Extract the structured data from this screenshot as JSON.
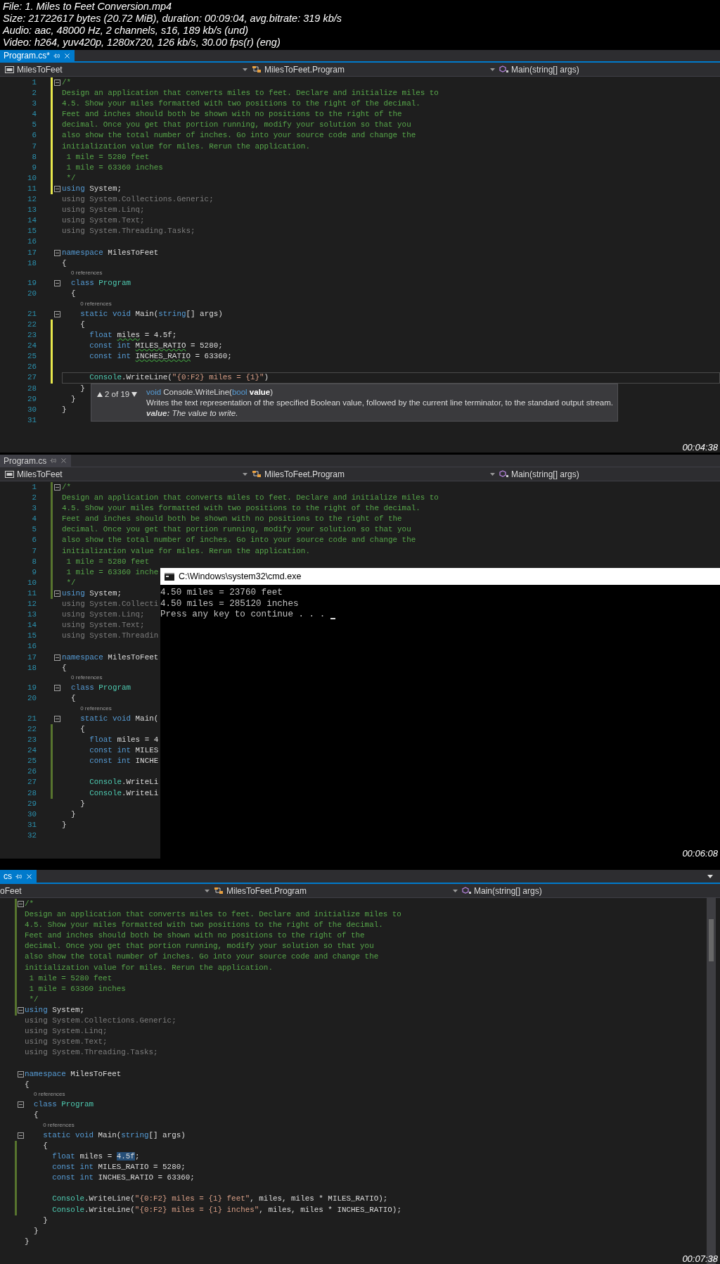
{
  "header": [
    "File: 1. Miles to Feet Conversion.mp4",
    "Size: 21722617 bytes (20.72 MiB), duration: 00:09:04, avg.bitrate: 319 kb/s",
    "Audio: aac, 48000 Hz, 2 channels, s16, 189 kb/s (und)",
    "Video: h264, yuv420p, 1280x720, 126 kb/s, 30.00 fps(r) (eng)"
  ],
  "frames": [
    {
      "kind": "full",
      "tab": {
        "label": "Program.cs*",
        "selected": true,
        "saved": false
      },
      "nav": [
        {
          "label": "MilesToFeet"
        },
        {
          "label": "MilesToFeet.Program"
        },
        {
          "label": "Main(string[] args)"
        }
      ],
      "lines": [
        {
          "kind": "code",
          "number": "1",
          "fold": true,
          "modified": true,
          "current": false,
          "segments": [
            {
              "kind": "comment",
              "text": "/*"
            }
          ]
        },
        {
          "kind": "code",
          "number": "2",
          "fold": false,
          "modified": true,
          "current": false,
          "segments": [
            {
              "kind": "comment",
              "text": "Design an application that converts miles to feet. Declare and initialize miles to"
            }
          ]
        },
        {
          "kind": "code",
          "number": "3",
          "fold": false,
          "modified": true,
          "current": false,
          "segments": [
            {
              "kind": "comment",
              "text": "4.5. Show your miles formatted with two positions to the right of the decimal."
            }
          ]
        },
        {
          "kind": "code",
          "number": "4",
          "fold": false,
          "modified": true,
          "current": false,
          "segments": [
            {
              "kind": "comment",
              "text": "Feet and inches should both be shown with no positions to the right of the"
            }
          ]
        },
        {
          "kind": "code",
          "number": "5",
          "fold": false,
          "modified": true,
          "current": false,
          "segments": [
            {
              "kind": "comment",
              "text": "decimal. Once you get that portion running, modify your solution so that you"
            }
          ]
        },
        {
          "kind": "code",
          "number": "6",
          "fold": false,
          "modified": true,
          "current": false,
          "segments": [
            {
              "kind": "comment",
              "text": "also show the total number of inches. Go into your source code and change the"
            }
          ]
        },
        {
          "kind": "code",
          "number": "7",
          "fold": false,
          "modified": true,
          "current": false,
          "segments": [
            {
              "kind": "comment",
              "text": "initialization value for miles. Rerun the application."
            }
          ]
        },
        {
          "kind": "code",
          "number": "8",
          "fold": false,
          "modified": true,
          "current": false,
          "segments": [
            {
              "kind": "comment",
              "text": " 1 mile = 5280 feet"
            }
          ]
        },
        {
          "kind": "code",
          "number": "9",
          "fold": false,
          "modified": true,
          "current": false,
          "segments": [
            {
              "kind": "comment",
              "text": " 1 mile = 63360 inches"
            }
          ]
        },
        {
          "kind": "code",
          "number": "10",
          "fold": false,
          "modified": true,
          "current": false,
          "segments": [
            {
              "kind": "comment",
              "text": " */"
            }
          ]
        },
        {
          "kind": "code",
          "number": "11",
          "fold": true,
          "modified": true,
          "current": false,
          "segments": [
            {
              "kind": "keyword",
              "text": "using"
            },
            {
              "kind": "plain",
              "text": " System;"
            }
          ]
        },
        {
          "kind": "code",
          "number": "12",
          "fold": false,
          "modified": false,
          "current": false,
          "segments": [
            {
              "kind": "dimmed",
              "text": "using System.Collections.Generic;"
            }
          ]
        },
        {
          "kind": "code",
          "number": "13",
          "fold": false,
          "modified": false,
          "current": false,
          "segments": [
            {
              "kind": "dimmed",
              "text": "using System.Linq;"
            }
          ]
        },
        {
          "kind": "code",
          "number": "14",
          "fold": false,
          "modified": false,
          "current": false,
          "segments": [
            {
              "kind": "dimmed",
              "text": "using System.Text;"
            }
          ]
        },
        {
          "kind": "code",
          "number": "15",
          "fold": false,
          "modified": false,
          "current": false,
          "segments": [
            {
              "kind": "dimmed",
              "text": "using System.Threading.Tasks;"
            }
          ]
        },
        {
          "kind": "code",
          "number": "16",
          "fold": false,
          "modified": false,
          "current": false
        },
        {
          "kind": "code",
          "number": "17",
          "fold": true,
          "modified": false,
          "current": false,
          "segments": [
            {
              "kind": "keyword",
              "text": "namespace"
            },
            {
              "kind": "plain",
              "text": " MilesToFeet"
            }
          ]
        },
        {
          "kind": "code",
          "number": "18",
          "fold": false,
          "modified": false,
          "current": false,
          "segments": [
            {
              "kind": "plain",
              "text": "{"
            }
          ]
        },
        {
          "kind": "codelens",
          "text": "0 references"
        },
        {
          "kind": "code",
          "number": "19",
          "fold": true,
          "modified": false,
          "current": false,
          "segments": [
            {
              "kind": "keyword",
              "text": "  class"
            },
            {
              "kind": "type",
              "text": " Program"
            }
          ]
        },
        {
          "kind": "code",
          "number": "20",
          "fold": false,
          "modified": false,
          "current": false,
          "segments": [
            {
              "kind": "plain",
              "text": "  {"
            }
          ]
        },
        {
          "kind": "codelens",
          "text": "0 references"
        },
        {
          "kind": "code",
          "number": "21",
          "fold": true,
          "modified": false,
          "current": false,
          "segments": [
            {
              "kind": "keyword",
              "text": "    static void"
            },
            {
              "kind": "plain",
              "text": " Main("
            },
            {
              "kind": "keyword",
              "text": "string"
            },
            {
              "kind": "plain",
              "text": "[] args)"
            }
          ]
        },
        {
          "kind": "code",
          "number": "22",
          "fold": false,
          "modified": true,
          "current": false,
          "segments": [
            {
              "kind": "plain",
              "text": "    {"
            }
          ]
        },
        {
          "kind": "code",
          "number": "23",
          "fold": false,
          "modified": true,
          "current": false,
          "segments": [
            {
              "kind": "keyword",
              "text": "      float "
            },
            {
              "kind": "warning",
              "text": "miles"
            },
            {
              "kind": "plain",
              "text": " = 4.5f;"
            }
          ]
        },
        {
          "kind": "code",
          "number": "24",
          "fold": false,
          "modified": true,
          "current": false,
          "segments": [
            {
              "kind": "keyword",
              "text": "      const int "
            },
            {
              "kind": "warning",
              "text": "MILES_RATIO"
            },
            {
              "kind": "plain",
              "text": " = 5280;"
            }
          ]
        },
        {
          "kind": "code",
          "number": "25",
          "fold": false,
          "modified": true,
          "current": false,
          "segments": [
            {
              "kind": "keyword",
              "text": "      const int "
            },
            {
              "kind": "warning",
              "text": "INCHES_RATIO"
            },
            {
              "kind": "plain",
              "text": " = 63360;"
            }
          ]
        },
        {
          "kind": "code",
          "number": "26",
          "fold": false,
          "modified": true,
          "current": false
        },
        {
          "kind": "code",
          "number": "27",
          "fold": false,
          "modified": true,
          "current": true,
          "segments": [
            {
              "kind": "type",
              "text": "      Console"
            },
            {
              "kind": "plain",
              "text": ".WriteLine("
            },
            {
              "kind": "string",
              "text": "\"{0:F2} miles = {1}\""
            },
            {
              "kind": "plain",
              "text": ")"
            }
          ]
        },
        {
          "kind": "code",
          "number": "28",
          "fold": false,
          "modified": false,
          "current": false,
          "segments": [
            {
              "kind": "plain",
              "text": "    }"
            }
          ]
        },
        {
          "kind": "code",
          "number": "29",
          "fold": false,
          "modified": false,
          "current": false,
          "segments": [
            {
              "kind": "plain",
              "text": "  }"
            }
          ]
        },
        {
          "kind": "code",
          "number": "30",
          "fold": false,
          "modified": false,
          "current": false,
          "segments": [
            {
              "kind": "plain",
              "text": "}"
            }
          ]
        },
        {
          "kind": "code",
          "number": "31",
          "fold": false,
          "modified": false,
          "current": false
        }
      ],
      "tooltip": {
        "counter": "2 of 19",
        "signature": [
          {
            "kind": "keyword",
            "text": "void"
          },
          {
            "kind": "plain",
            "text": " Console.WriteLine("
          },
          {
            "kind": "keyword",
            "text": "bool"
          },
          {
            "kind": "param",
            "text": " value"
          },
          {
            "kind": "plain",
            "text": ")"
          }
        ],
        "description": "Writes the text representation of the specified Boolean value, followed by the current line terminator, to the standard output stream.",
        "parameter": "**value:** The value to write."
      },
      "timestamp": "00:04:38"
    },
    {
      "kind": "full",
      "tab": {
        "label": "Program.cs",
        "selected": false,
        "saved": true
      },
      "nav": [
        {
          "label": "MilesToFeet"
        },
        {
          "label": "MilesToFeet.Program"
        },
        {
          "label": "Main(string[] args)"
        }
      ],
      "lines": [
        {
          "kind": "code",
          "number": "1",
          "fold": true,
          "modified": true,
          "segments": [
            {
              "kind": "comment",
              "text": "/*"
            }
          ]
        },
        {
          "kind": "code",
          "number": "2",
          "fold": false,
          "modified": true,
          "segments": [
            {
              "kind": "comment",
              "text": "Design an application that converts miles to feet. Declare and initialize miles to"
            }
          ]
        },
        {
          "kind": "code",
          "number": "3",
          "fold": false,
          "modified": true,
          "segments": [
            {
              "kind": "comment",
              "text": "4.5. Show your miles formatted with two positions to the right of the decimal."
            }
          ]
        },
        {
          "kind": "code",
          "number": "4",
          "fold": false,
          "modified": true,
          "segments": [
            {
              "kind": "comment",
              "text": "Feet and inches should both be shown with no positions to the right of the"
            }
          ]
        },
        {
          "kind": "code",
          "number": "5",
          "fold": false,
          "modified": true,
          "segments": [
            {
              "kind": "comment",
              "text": "decimal. Once you get that portion running, modify your solution so that you"
            }
          ]
        },
        {
          "kind": "code",
          "number": "6",
          "fold": false,
          "modified": true,
          "segments": [
            {
              "kind": "comment",
              "text": "also show the total number of inches. Go into your source code and change the"
            }
          ]
        },
        {
          "kind": "code",
          "number": "7",
          "fold": false,
          "modified": true,
          "segments": [
            {
              "kind": "comment",
              "text": "initialization value for miles. Rerun the application."
            }
          ]
        },
        {
          "kind": "code",
          "number": "8",
          "fold": false,
          "modified": true,
          "segments": [
            {
              "kind": "comment",
              "text": " 1 mile = 5280 feet"
            }
          ]
        },
        {
          "kind": "code",
          "number": "9",
          "fold": false,
          "modified": true,
          "segments": [
            {
              "kind": "comment",
              "text": " 1 mile = 63360 inche"
            }
          ]
        },
        {
          "kind": "code",
          "number": "10",
          "fold": false,
          "modified": true,
          "segments": [
            {
              "kind": "comment",
              "text": " */"
            }
          ]
        },
        {
          "kind": "code",
          "number": "11",
          "fold": true,
          "modified": true,
          "segments": [
            {
              "kind": "keyword",
              "text": "using"
            },
            {
              "kind": "plain",
              "text": " System;"
            }
          ]
        },
        {
          "kind": "code",
          "number": "12",
          "fold": false,
          "modified": false,
          "segments": [
            {
              "kind": "dimmed",
              "text": "using System.Collecti"
            }
          ]
        },
        {
          "kind": "code",
          "number": "13",
          "fold": false,
          "modified": false,
          "segments": [
            {
              "kind": "dimmed",
              "text": "using System.Linq;"
            }
          ]
        },
        {
          "kind": "code",
          "number": "14",
          "fold": false,
          "modified": false,
          "segments": [
            {
              "kind": "dimmed",
              "text": "using System.Text;"
            }
          ]
        },
        {
          "kind": "code",
          "number": "15",
          "fold": false,
          "modified": false,
          "segments": [
            {
              "kind": "dimmed",
              "text": "using System.Threadin"
            }
          ]
        },
        {
          "kind": "code",
          "number": "16",
          "fold": false,
          "modified": false
        },
        {
          "kind": "code",
          "number": "17",
          "fold": true,
          "modified": false,
          "segments": [
            {
              "kind": "keyword",
              "text": "namespace"
            },
            {
              "kind": "plain",
              "text": " MilesToFeet"
            }
          ]
        },
        {
          "kind": "code",
          "number": "18",
          "fold": false,
          "modified": false,
          "segments": [
            {
              "kind": "plain",
              "text": "{"
            }
          ]
        },
        {
          "kind": "codelens",
          "text": "0 references"
        },
        {
          "kind": "code",
          "number": "19",
          "fold": true,
          "modified": false,
          "segments": [
            {
              "kind": "keyword",
              "text": "  class"
            },
            {
              "kind": "type",
              "text": " Program"
            }
          ]
        },
        {
          "kind": "code",
          "number": "20",
          "fold": false,
          "modified": false,
          "segments": [
            {
              "kind": "plain",
              "text": "  {"
            }
          ]
        },
        {
          "kind": "codelens",
          "text": "0 references"
        },
        {
          "kind": "code",
          "number": "21",
          "fold": true,
          "modified": false,
          "segments": [
            {
              "kind": "keyword",
              "text": "    static void"
            },
            {
              "kind": "plain",
              "text": " Main("
            }
          ]
        },
        {
          "kind": "code",
          "number": "22",
          "fold": false,
          "modified": true,
          "segments": [
            {
              "kind": "plain",
              "text": "    {"
            }
          ]
        },
        {
          "kind": "code",
          "number": "23",
          "fold": false,
          "modified": true,
          "segments": [
            {
              "kind": "keyword",
              "text": "      float"
            },
            {
              "kind": "plain",
              "text": " miles = 4"
            }
          ]
        },
        {
          "kind": "code",
          "number": "24",
          "fold": false,
          "modified": true,
          "segments": [
            {
              "kind": "keyword",
              "text": "      const int"
            },
            {
              "kind": "plain",
              "text": " MILES"
            }
          ]
        },
        {
          "kind": "code",
          "number": "25",
          "fold": false,
          "modified": true,
          "segments": [
            {
              "kind": "keyword",
              "text": "      const int"
            },
            {
              "kind": "plain",
              "text": " INCHE"
            }
          ]
        },
        {
          "kind": "code",
          "number": "26",
          "fold": false,
          "modified": true
        },
        {
          "kind": "code",
          "number": "27",
          "fold": false,
          "modified": true,
          "segments": [
            {
              "kind": "type",
              "text": "      Console"
            },
            {
              "kind": "plain",
              "text": ".WriteLi"
            }
          ]
        },
        {
          "kind": "code",
          "number": "28",
          "fold": false,
          "modified": true,
          "segments": [
            {
              "kind": "type",
              "text": "      Console"
            },
            {
              "kind": "plain",
              "text": ".WriteLi"
            }
          ]
        },
        {
          "kind": "code",
          "number": "29",
          "fold": false,
          "modified": false,
          "segments": [
            {
              "kind": "plain",
              "text": "    }"
            }
          ]
        },
        {
          "kind": "code",
          "number": "30",
          "fold": false,
          "modified": false,
          "segments": [
            {
              "kind": "plain",
              "text": "  }"
            }
          ]
        },
        {
          "kind": "code",
          "number": "31",
          "fold": false,
          "modified": false,
          "segments": [
            {
              "kind": "plain",
              "text": "}"
            }
          ]
        },
        {
          "kind": "code",
          "number": "32",
          "fold": false,
          "modified": false
        }
      ],
      "console": {
        "title": "C:\\Windows\\system32\\cmd.exe",
        "lines": [
          "4.50 miles = 23760 feet",
          "4.50 miles = 285120 inches",
          "Press any key to continue . . ."
        ]
      },
      "timestamp": "00:06:08"
    },
    {
      "kind": "cropped",
      "tab": {
        "label": "cs",
        "selected": true,
        "saved": true
      },
      "nav": [
        {
          "label": "oFeet"
        },
        {
          "label": "MilesToFeet.Program"
        },
        {
          "label": "Main(string[] args)"
        }
      ],
      "lines": [
        {
          "kind": "code",
          "fold": true,
          "modified": true,
          "segments": [
            {
              "kind": "comment",
              "text": "/*"
            }
          ]
        },
        {
          "kind": "code",
          "fold": false,
          "modified": true,
          "segments": [
            {
              "kind": "comment",
              "text": "Design an application that converts miles to feet. Declare and initialize miles to"
            }
          ]
        },
        {
          "kind": "code",
          "fold": false,
          "modified": true,
          "segments": [
            {
              "kind": "comment",
              "text": "4.5. Show your miles formatted with two positions to the right of the decimal."
            }
          ]
        },
        {
          "kind": "code",
          "fold": false,
          "modified": true,
          "segments": [
            {
              "kind": "comment",
              "text": "Feet and inches should both be shown with no positions to the right of the"
            }
          ]
        },
        {
          "kind": "code",
          "fold": false,
          "modified": true,
          "segments": [
            {
              "kind": "comment",
              "text": "decimal. Once you get that portion running, modify your solution so that you"
            }
          ]
        },
        {
          "kind": "code",
          "fold": false,
          "modified": true,
          "segments": [
            {
              "kind": "comment",
              "text": "also show the total number of inches. Go into your source code and change the"
            }
          ]
        },
        {
          "kind": "code",
          "fold": false,
          "modified": true,
          "segments": [
            {
              "kind": "comment",
              "text": "initialization value for miles. Rerun the application."
            }
          ]
        },
        {
          "kind": "code",
          "fold": false,
          "modified": true,
          "segments": [
            {
              "kind": "comment",
              "text": " 1 mile = 5280 feet"
            }
          ]
        },
        {
          "kind": "code",
          "fold": false,
          "modified": true,
          "segments": [
            {
              "kind": "comment",
              "text": " 1 mile = 63360 inches"
            }
          ]
        },
        {
          "kind": "code",
          "fold": false,
          "modified": true,
          "segments": [
            {
              "kind": "comment",
              "text": " */"
            }
          ]
        },
        {
          "kind": "code",
          "fold": true,
          "modified": true,
          "segments": [
            {
              "kind": "keyword",
              "text": "using"
            },
            {
              "kind": "plain",
              "text": " System;"
            }
          ]
        },
        {
          "kind": "code",
          "fold": false,
          "modified": false,
          "segments": [
            {
              "kind": "dimmed",
              "text": "using System.Collections.Generic;"
            }
          ]
        },
        {
          "kind": "code",
          "fold": false,
          "modified": false,
          "segments": [
            {
              "kind": "dimmed",
              "text": "using System.Linq;"
            }
          ]
        },
        {
          "kind": "code",
          "fold": false,
          "modified": false,
          "segments": [
            {
              "kind": "dimmed",
              "text": "using System.Text;"
            }
          ]
        },
        {
          "kind": "code",
          "fold": false,
          "modified": false,
          "segments": [
            {
              "kind": "dimmed",
              "text": "using System.Threading.Tasks;"
            }
          ]
        },
        {
          "kind": "code",
          "fold": false,
          "modified": false
        },
        {
          "kind": "code",
          "fold": true,
          "modified": false,
          "segments": [
            {
              "kind": "keyword",
              "text": "namespace"
            },
            {
              "kind": "plain",
              "text": " MilesToFeet"
            }
          ]
        },
        {
          "kind": "code",
          "fold": false,
          "modified": false,
          "segments": [
            {
              "kind": "plain",
              "text": "{"
            }
          ]
        },
        {
          "kind": "codelens",
          "text": "0 references"
        },
        {
          "kind": "code",
          "fold": true,
          "modified": false,
          "segments": [
            {
              "kind": "keyword",
              "text": "  class"
            },
            {
              "kind": "type",
              "text": " Program"
            }
          ]
        },
        {
          "kind": "code",
          "fold": false,
          "modified": false,
          "segments": [
            {
              "kind": "plain",
              "text": "  {"
            }
          ]
        },
        {
          "kind": "codelens",
          "text": "0 references"
        },
        {
          "kind": "code",
          "fold": true,
          "modified": false,
          "segments": [
            {
              "kind": "keyword",
              "text": "    static void"
            },
            {
              "kind": "plain",
              "text": " Main("
            },
            {
              "kind": "keyword",
              "text": "string"
            },
            {
              "kind": "plain",
              "text": "[] args)"
            }
          ]
        },
        {
          "kind": "code",
          "fold": false,
          "modified": true,
          "segments": [
            {
              "kind": "plain",
              "text": "    {"
            }
          ]
        },
        {
          "kind": "code",
          "fold": false,
          "modified": true,
          "segments": [
            {
              "kind": "keyword",
              "text": "      float"
            },
            {
              "kind": "plain",
              "text": " miles = "
            },
            {
              "kind": "selected",
              "text": "4.5f"
            },
            {
              "kind": "plain",
              "text": ";"
            }
          ]
        },
        {
          "kind": "code",
          "fold": false,
          "modified": true,
          "segments": [
            {
              "kind": "keyword",
              "text": "      const int"
            },
            {
              "kind": "plain",
              "text": " MILES_RATIO = 5280;"
            }
          ]
        },
        {
          "kind": "code",
          "fold": false,
          "modified": true,
          "segments": [
            {
              "kind": "keyword",
              "text": "      const int"
            },
            {
              "kind": "plain",
              "text": " INCHES_RATIO = 63360;"
            }
          ]
        },
        {
          "kind": "code",
          "fold": false,
          "modified": true
        },
        {
          "kind": "code",
          "fold": false,
          "modified": true,
          "segments": [
            {
              "kind": "type",
              "text": "      Console"
            },
            {
              "kind": "plain",
              "text": ".WriteLine("
            },
            {
              "kind": "string",
              "text": "\"{0:F2} miles = {1} feet\""
            },
            {
              "kind": "plain",
              "text": ", miles, miles * MILES_RATIO);"
            }
          ]
        },
        {
          "kind": "code",
          "fold": false,
          "modified": true,
          "segments": [
            {
              "kind": "type",
              "text": "      Console"
            },
            {
              "kind": "plain",
              "text": ".WriteLine("
            },
            {
              "kind": "string",
              "text": "\"{0:F2} miles = {1} inches\""
            },
            {
              "kind": "plain",
              "text": ", miles, miles * INCHES_RATIO);"
            }
          ]
        },
        {
          "kind": "code",
          "fold": false,
          "modified": false,
          "segments": [
            {
              "kind": "plain",
              "text": "    }"
            }
          ]
        },
        {
          "kind": "code",
          "fold": false,
          "modified": false,
          "segments": [
            {
              "kind": "plain",
              "text": "  }"
            }
          ]
        },
        {
          "kind": "code",
          "fold": false,
          "modified": false,
          "segments": [
            {
              "kind": "plain",
              "text": "}"
            }
          ]
        }
      ],
      "timestamp": "00:07:38"
    }
  ]
}
